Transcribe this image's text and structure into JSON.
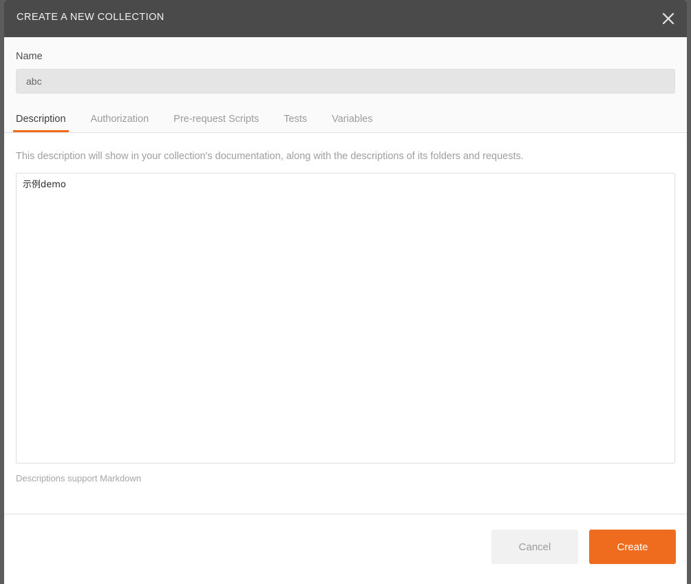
{
  "window": {
    "title": "CREATE A NEW COLLECTION",
    "close_icon": "close-icon",
    "header_bg": "#4a4a4a",
    "accent_color": "#ef6c1f"
  },
  "name_field": {
    "label": "Name",
    "value": "abc",
    "placeholder": "abc"
  },
  "tabs": [
    {
      "label": "Description",
      "active": true
    },
    {
      "label": "Authorization",
      "active": false
    },
    {
      "label": "Pre-request Scripts",
      "active": false
    },
    {
      "label": "Tests",
      "active": false
    },
    {
      "label": "Variables",
      "active": false
    }
  ],
  "description_panel": {
    "hint": "This description will show in your collection's documentation, along with the descriptions of its folders and requests.",
    "textarea_value": "示例demo",
    "textarea_placeholder": "",
    "markdown_note": "Descriptions support Markdown"
  },
  "footer": {
    "cancel_label": "Cancel",
    "create_label": "Create"
  }
}
